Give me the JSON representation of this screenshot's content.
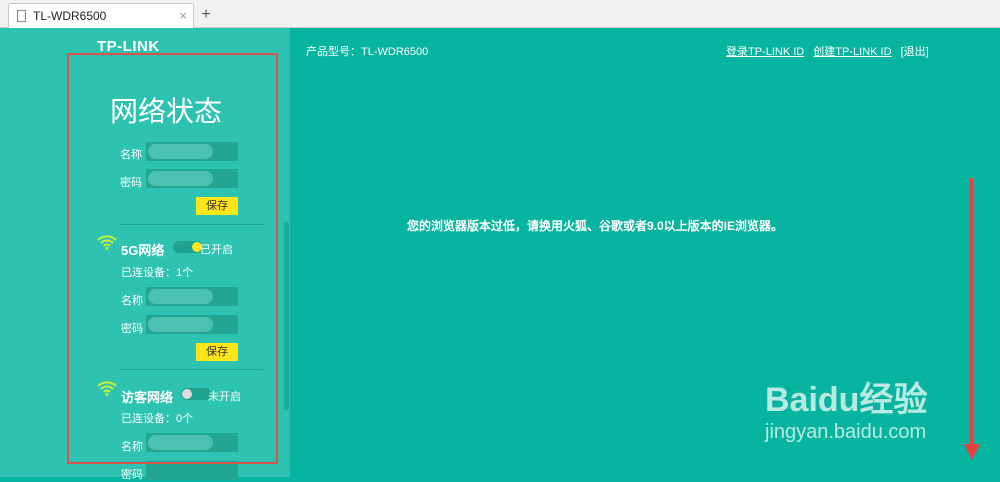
{
  "browser": {
    "tab_title": "TL-WDR6500",
    "close": "×",
    "new_tab": "+"
  },
  "sidebar": {
    "logo": "TP-LINK",
    "title": "网络状态",
    "main": {
      "name_label": "名称",
      "password_label": "密码",
      "save": "保存"
    },
    "net5g": {
      "title": "5G网络",
      "status": "已开启",
      "devices": "已连设备：1个",
      "name_label": "名称",
      "password_label": "密码",
      "save": "保存"
    },
    "guest": {
      "title": "访客网络",
      "status": "未开启",
      "devices": "已连设备：0个",
      "name_label": "名称",
      "password_label": "密码"
    }
  },
  "header": {
    "model": "产品型号：TL-WDR6500",
    "login": "登录TP-LINK ID",
    "create": "创建TP-LINK ID",
    "logout": "[退出]"
  },
  "main": {
    "message": "您的浏览器版本过低，请换用火狐、谷歌或者9.0以上版本的IE浏览器。"
  },
  "watermark": {
    "brand": "Baidu经验",
    "url": "jingyan.baidu.com"
  }
}
